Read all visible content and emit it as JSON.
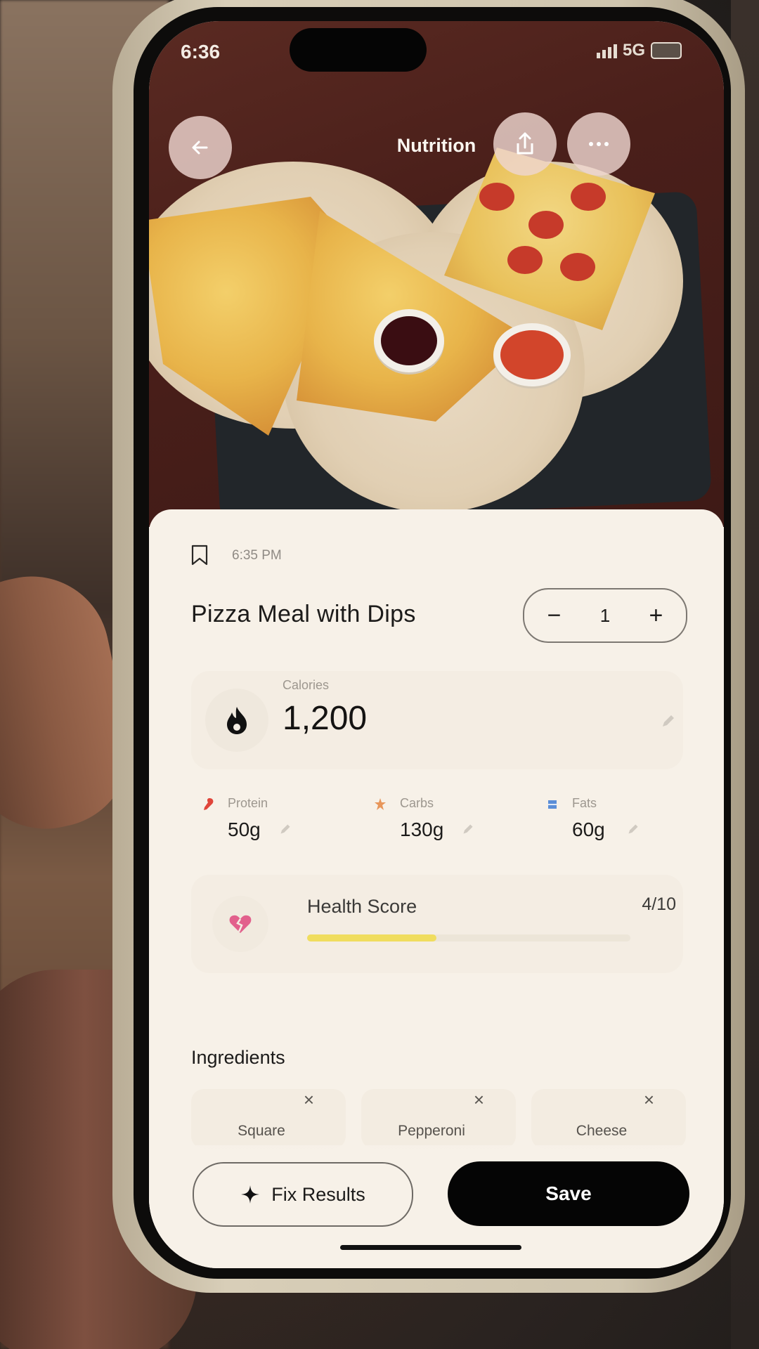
{
  "status": {
    "time": "6:36",
    "network": "5G"
  },
  "nav": {
    "title": "Nutrition",
    "back_icon": "arrow-left-icon",
    "share_icon": "share-icon",
    "more_icon": "more-dots-icon"
  },
  "meal": {
    "timestamp": "6:35 PM",
    "name": "Pizza Meal with Dips",
    "quantity": "1",
    "decrement_label": "−",
    "increment_label": "+"
  },
  "calories": {
    "label": "Calories",
    "value": "1,200"
  },
  "macros": [
    {
      "label": "Protein",
      "value": "50g",
      "color": "#e0453a",
      "icon": "protein-icon"
    },
    {
      "label": "Carbs",
      "value": "130g",
      "color": "#e8965a",
      "icon": "carbs-icon"
    },
    {
      "label": "Fats",
      "value": "60g",
      "color": "#5b8ed8",
      "icon": "fats-icon"
    }
  ],
  "health": {
    "label": "Health Score",
    "value": "4/10",
    "score_fraction": 0.4,
    "bar_color": "#f0dd5e",
    "icon": "broken-heart-icon"
  },
  "ingredients": {
    "title": "Ingredients",
    "items": [
      {
        "name": "Square"
      },
      {
        "name": "Pepperoni"
      },
      {
        "name": "Cheese"
      }
    ],
    "remove_label": "×"
  },
  "actions": {
    "fix_label": "Fix Results",
    "save_label": "Save"
  }
}
